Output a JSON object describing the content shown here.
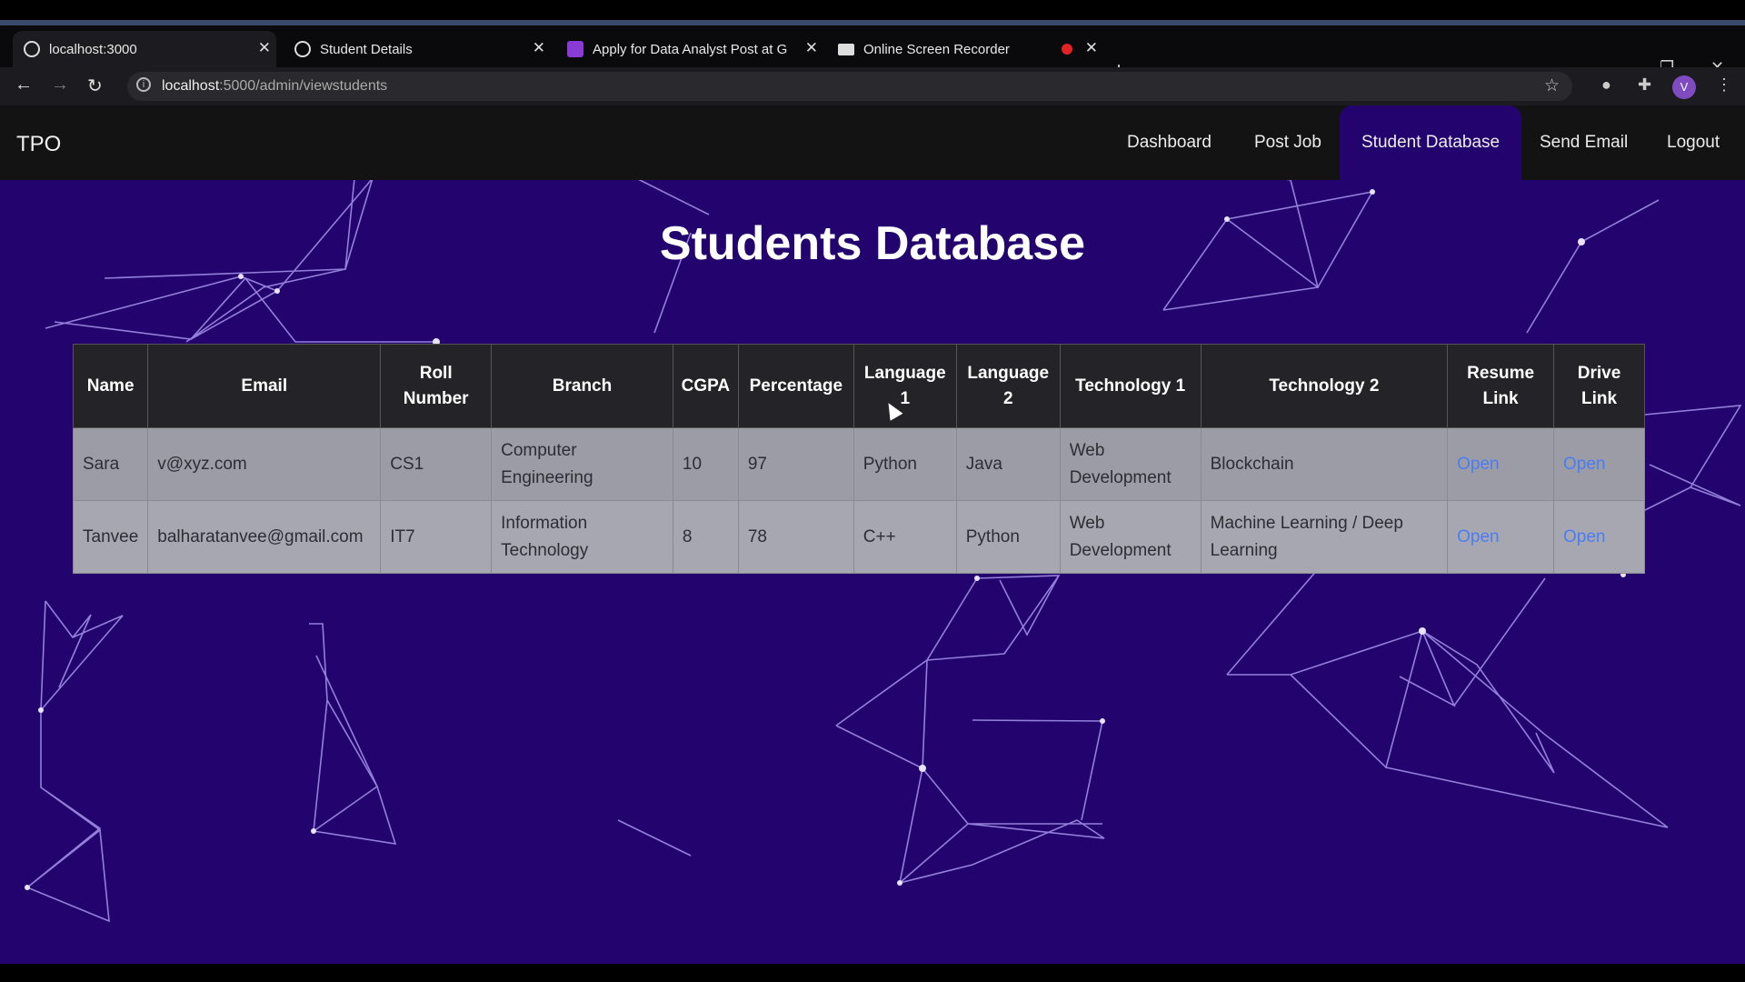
{
  "browser": {
    "tabs": [
      {
        "title": "localhost:3000",
        "active": true
      },
      {
        "title": "Student Details",
        "active": false
      },
      {
        "title": "Apply for Data Analyst Post at G",
        "active": false
      },
      {
        "title": "Online Screen Recorder",
        "active": false
      }
    ],
    "url_host": "localhost",
    "url_path": ":5000/admin/viewstudents",
    "avatar_letter": "V"
  },
  "nav": {
    "brand": "TPO",
    "links": [
      "Dashboard",
      "Post Job",
      "Student Database",
      "Send Email",
      "Logout"
    ],
    "active": "Student Database"
  },
  "page": {
    "title": "Students Database"
  },
  "table": {
    "headers": [
      "Name",
      "Email",
      "Roll Number",
      "Branch",
      "CGPA",
      "Percentage",
      "Language 1",
      "Language 2",
      "Technology 1",
      "Technology 2",
      "Resume Link",
      "Drive Link"
    ],
    "rows": [
      [
        "Sara",
        "v@xyz.com",
        "CS1",
        "Computer Engineering",
        "10",
        "97",
        "Python",
        "Java",
        "Web Development",
        "Blockchain",
        "Open",
        "Open"
      ],
      [
        "Tanvee",
        "balharatanvee@gmail.com",
        "IT7",
        "Information Technology",
        "8",
        "78",
        "C++",
        "Python",
        "Web Development",
        "Machine Learning / Deep Learning",
        "Open",
        "Open"
      ]
    ]
  },
  "colors": {
    "page_bg": "#23046e",
    "navbar_bg": "#131313",
    "table_header_bg": "#232328",
    "table_row_bg": "#9c9ca6",
    "link": "#4b7df2"
  }
}
